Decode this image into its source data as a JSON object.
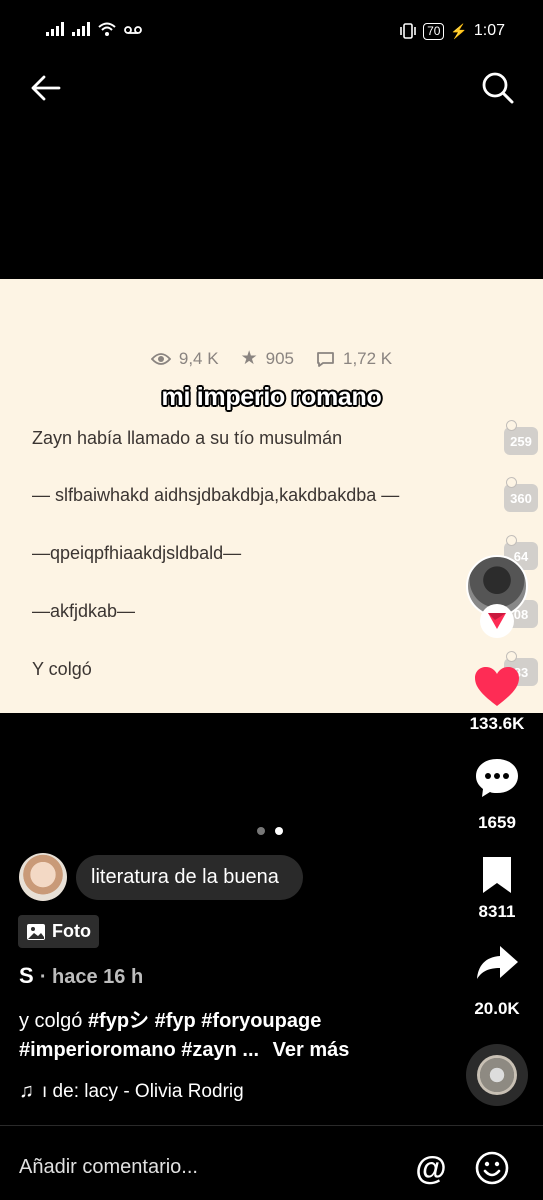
{
  "status_bar": {
    "time": "1:07",
    "battery": "70"
  },
  "stats": {
    "views": "9,4 K",
    "stars": "905",
    "comments": "1,72 K"
  },
  "story": {
    "title": "mi imperio romano",
    "lines": [
      "Zayn había llamado a su tío musulmán",
      "— slfbaiwhakd aidhsjdbakdbja,kakdbakdba —",
      "—qpeiqpfhiaakdjsldbald—",
      "—akfjdkab—",
      "Y colgó"
    ],
    "comment_badges": [
      "259",
      "360",
      "64",
      "08",
      "83"
    ]
  },
  "rail": {
    "likes": "133.6K",
    "comments": "1659",
    "saves": "8311",
    "shares": "20.0K"
  },
  "carousel": {
    "pages": 2,
    "active": 2
  },
  "caption": {
    "bubble_text": "literatura de la buena",
    "type_label": "Foto",
    "author": "S",
    "time": "hace 16 h",
    "text_prefix": "y colgó",
    "hashtags_line1": "#fypシ #fyp #foryoupage",
    "hashtags_line2": "#imperioromano #zayn ...",
    "see_more": "Ver más",
    "music": "ı de: lacy - Olivia Rodrig"
  },
  "bottom": {
    "placeholder": "Añadir comentario..."
  },
  "colors": {
    "like_red": "#fe2c55",
    "panel_bg": "#fdf4e4"
  }
}
